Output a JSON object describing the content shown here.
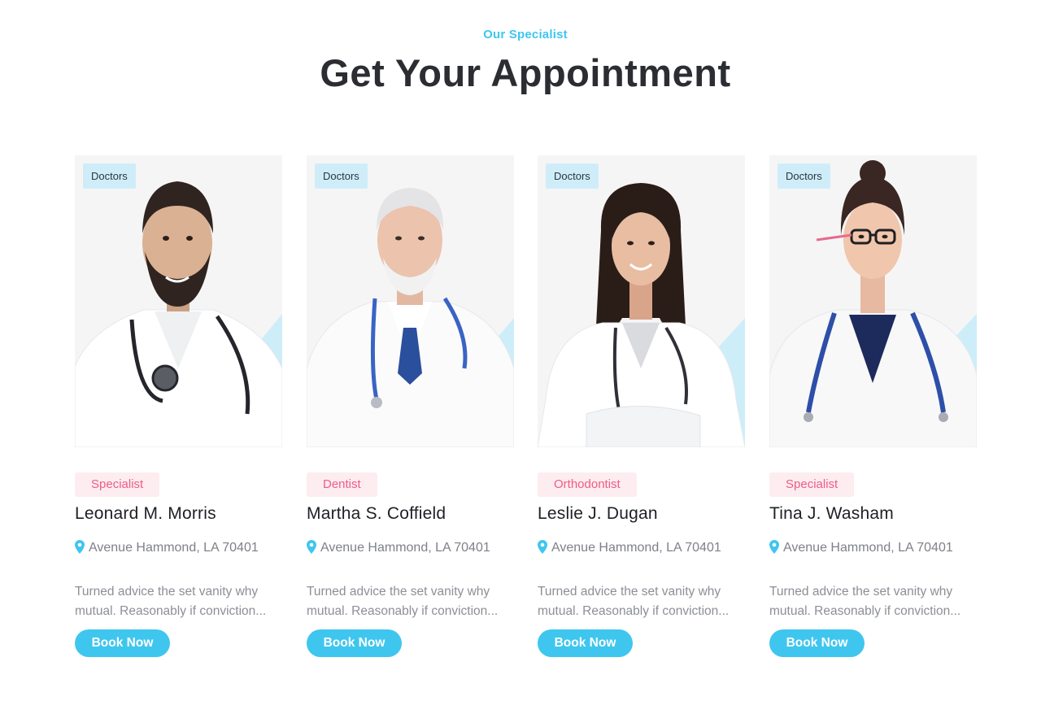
{
  "header": {
    "eyebrow": "Our Specialist",
    "title": "Get Your Appointment"
  },
  "colors": {
    "accent": "#3fc6ef",
    "badge_bg": "#fdecf0",
    "badge_text": "#ef5d86",
    "category_bg": "#cbebf7"
  },
  "doctors": [
    {
      "category": "Doctors",
      "specialty": "Specialist",
      "name": "Leonard M. Morris",
      "address": "Avenue Hammond, LA 70401",
      "description_line1": "Turned advice the set vanity why",
      "description_line2": "mutual. Reasonably if conviction...",
      "button": "Book Now",
      "photo": "male-doctor-bearded-photo"
    },
    {
      "category": "Doctors",
      "specialty": "Dentist",
      "name": "Martha S. Coffield",
      "address": "Avenue Hammond, LA 70401",
      "description_line1": "Turned advice the set vanity why",
      "description_line2": "mutual. Reasonably if conviction...",
      "button": "Book Now",
      "photo": "senior-doctor-white-hair-photo"
    },
    {
      "category": "Doctors",
      "specialty": "Orthodontist",
      "name": "Leslie J. Dugan",
      "address": "Avenue Hammond, LA 70401",
      "description_line1": "Turned advice the set vanity why",
      "description_line2": "mutual. Reasonably if conviction...",
      "button": "Book Now",
      "photo": "female-doctor-smiling-photo"
    },
    {
      "category": "Doctors",
      "specialty": "Specialist",
      "name": "Tina J. Washam",
      "address": "Avenue Hammond, LA 70401",
      "description_line1": "Turned advice the set vanity why",
      "description_line2": "mutual. Reasonably if conviction...",
      "button": "Book Now",
      "photo": "female-doctor-glasses-photo"
    }
  ]
}
